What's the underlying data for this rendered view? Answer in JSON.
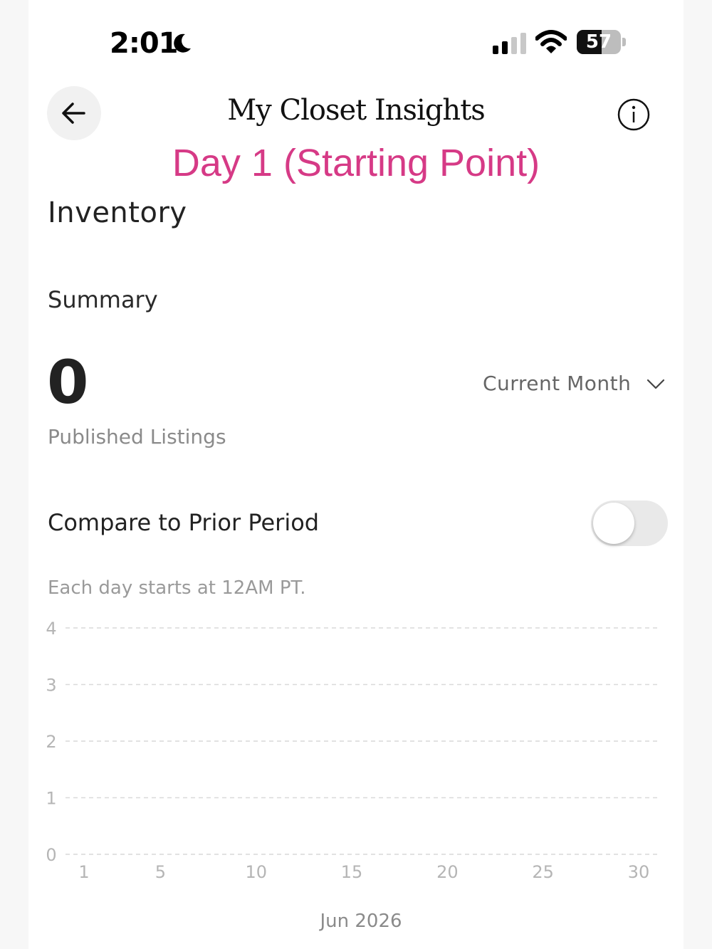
{
  "status_bar": {
    "time": "2:01",
    "battery": "57",
    "battery_level": 0.57
  },
  "header": {
    "title": "My Closet Insights"
  },
  "overlay_caption": "Day 1 (Starting Point)",
  "inventory": {
    "heading": "Inventory",
    "summary_heading": "Summary",
    "published_count": "0",
    "published_label": "Published Listings",
    "period_selected": "Current Month",
    "compare_label": "Compare to Prior Period",
    "compare_enabled": false,
    "note": "Each day starts at 12AM PT."
  },
  "colors": {
    "accent": "#d63a86",
    "grid": "#d9d9d9",
    "axis_text": "#b5b5b5"
  },
  "chart_data": {
    "type": "line",
    "xlabel": "Jun 2026",
    "x_ticks": [
      1,
      5,
      10,
      15,
      20,
      25,
      30
    ],
    "y_ticks": [
      0,
      1,
      2,
      3,
      4
    ],
    "xlim": [
      1,
      30
    ],
    "ylim": [
      0,
      4
    ],
    "grid": true,
    "series": []
  }
}
